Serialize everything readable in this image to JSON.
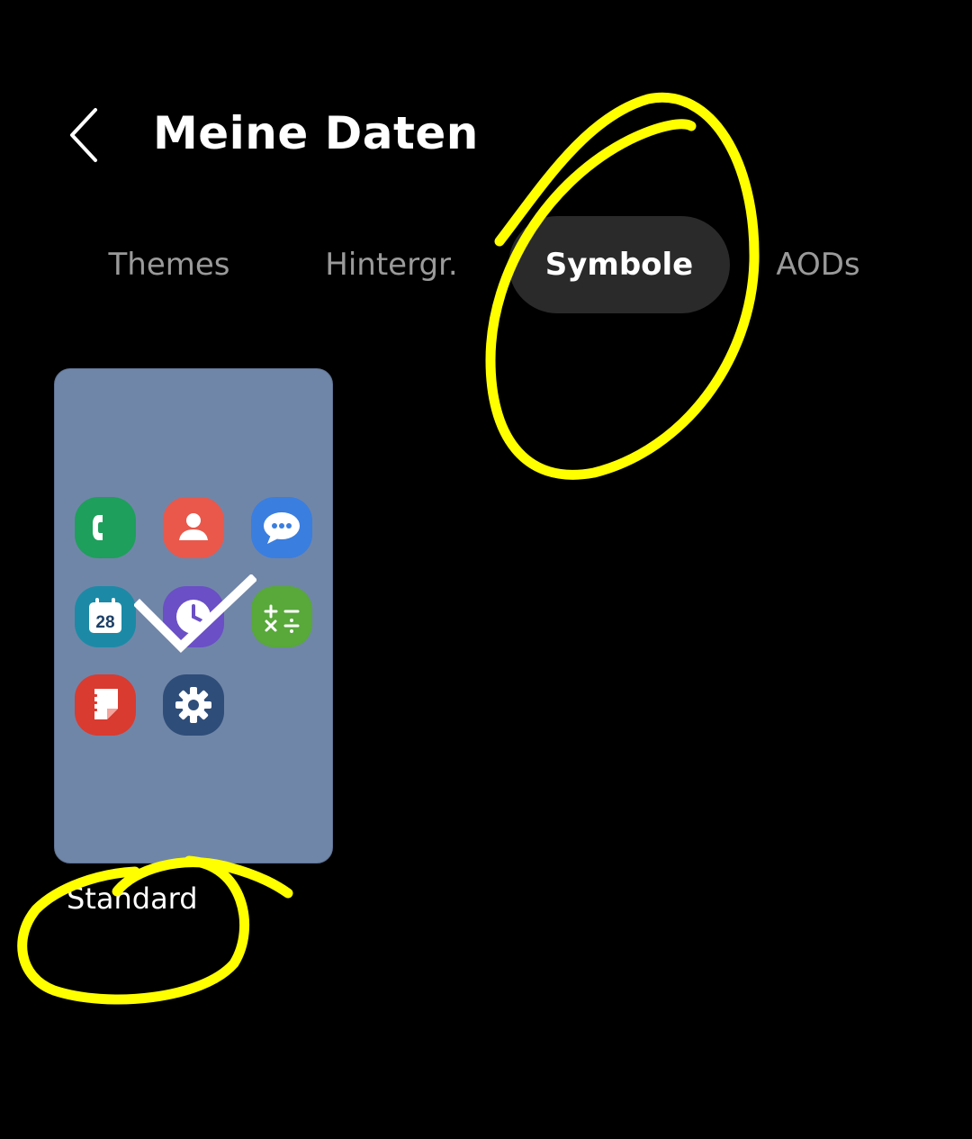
{
  "header": {
    "title": "Meine Daten",
    "back_icon": "chevron-left-icon"
  },
  "tabs": [
    {
      "label": "Themes",
      "selected": false
    },
    {
      "label": "Hintergr.",
      "selected": false
    },
    {
      "label": "Symbole",
      "selected": true
    },
    {
      "label": "AODs",
      "selected": false
    }
  ],
  "icon_pack": {
    "name": "Standard",
    "applied": true,
    "preview_icons": [
      "phone-icon",
      "contacts-icon",
      "messages-icon",
      "calendar-icon",
      "clock-icon",
      "calculator-icon",
      "notes-icon",
      "settings-icon"
    ],
    "calendar_day": "28"
  },
  "colors": {
    "background": "#000000",
    "selected_tab": "#2a2a2a",
    "card": "#7086a8",
    "annotation": "#ffff00"
  }
}
